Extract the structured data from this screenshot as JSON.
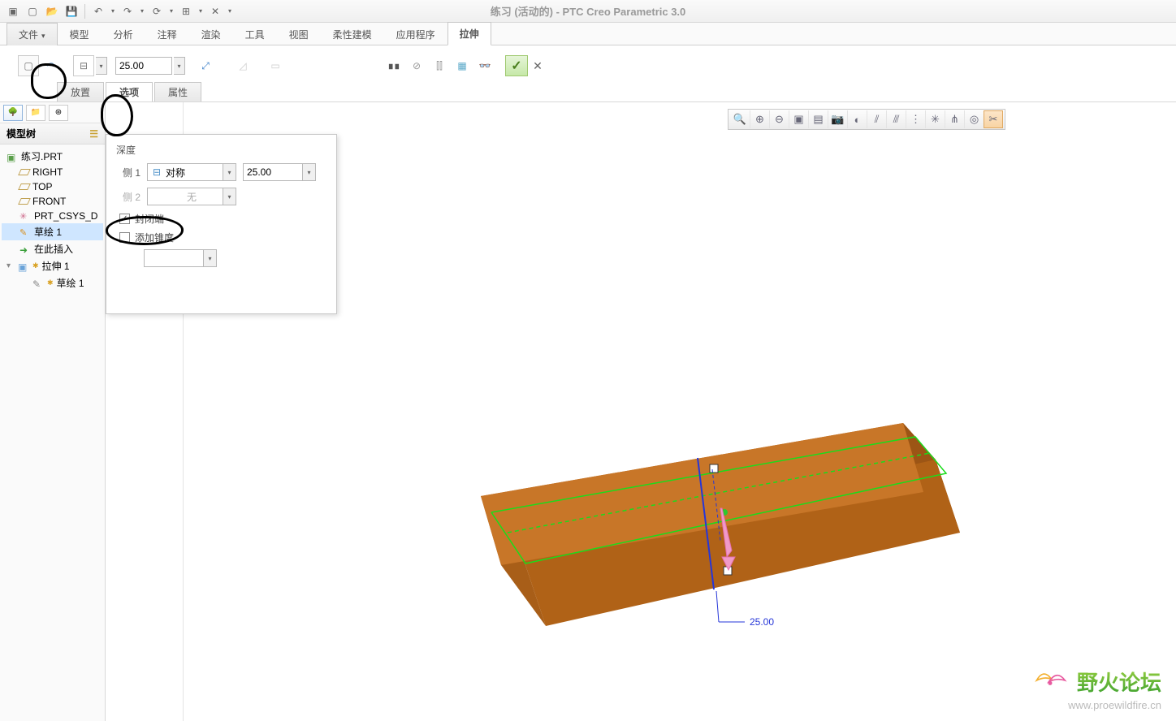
{
  "app": {
    "title": "练习 (活动的) - PTC Creo Parametric 3.0"
  },
  "ribbon": {
    "file": "文件",
    "tabs": [
      "模型",
      "分析",
      "注释",
      "渲染",
      "工具",
      "视图",
      "柔性建模",
      "应用程序",
      "拉伸"
    ],
    "active_index": 8
  },
  "feature": {
    "depth_value": "25.00",
    "sub_tabs": [
      "放置",
      "选项",
      "属性"
    ],
    "sub_active_index": 1
  },
  "left_panel": {
    "header": "模型树",
    "root": "练习.PRT",
    "items": [
      {
        "label": "RIGHT",
        "icon": "plane"
      },
      {
        "label": "TOP",
        "icon": "plane"
      },
      {
        "label": "FRONT",
        "icon": "plane"
      },
      {
        "label": "PRT_CSYS_D",
        "icon": "csys"
      },
      {
        "label": "草绘 1",
        "icon": "sketch",
        "selected": true
      },
      {
        "label": "在此插入",
        "icon": "arrow"
      }
    ],
    "extrude_node": "拉伸 1",
    "extrude_child": "草绘 1"
  },
  "options_panel": {
    "depth_label": "深度",
    "side1_label": "侧 1",
    "side1_type": "对称",
    "side1_value": "25.00",
    "side2_label": "侧 2",
    "side2_type": "无",
    "closed_ends": "封闭端",
    "closed_ends_checked": true,
    "add_taper": "添加锥度",
    "add_taper_checked": false
  },
  "viewport": {
    "dimension_label": "25.00"
  },
  "watermark": {
    "name": "野火论坛",
    "url": "www.proewildfire.cn"
  }
}
